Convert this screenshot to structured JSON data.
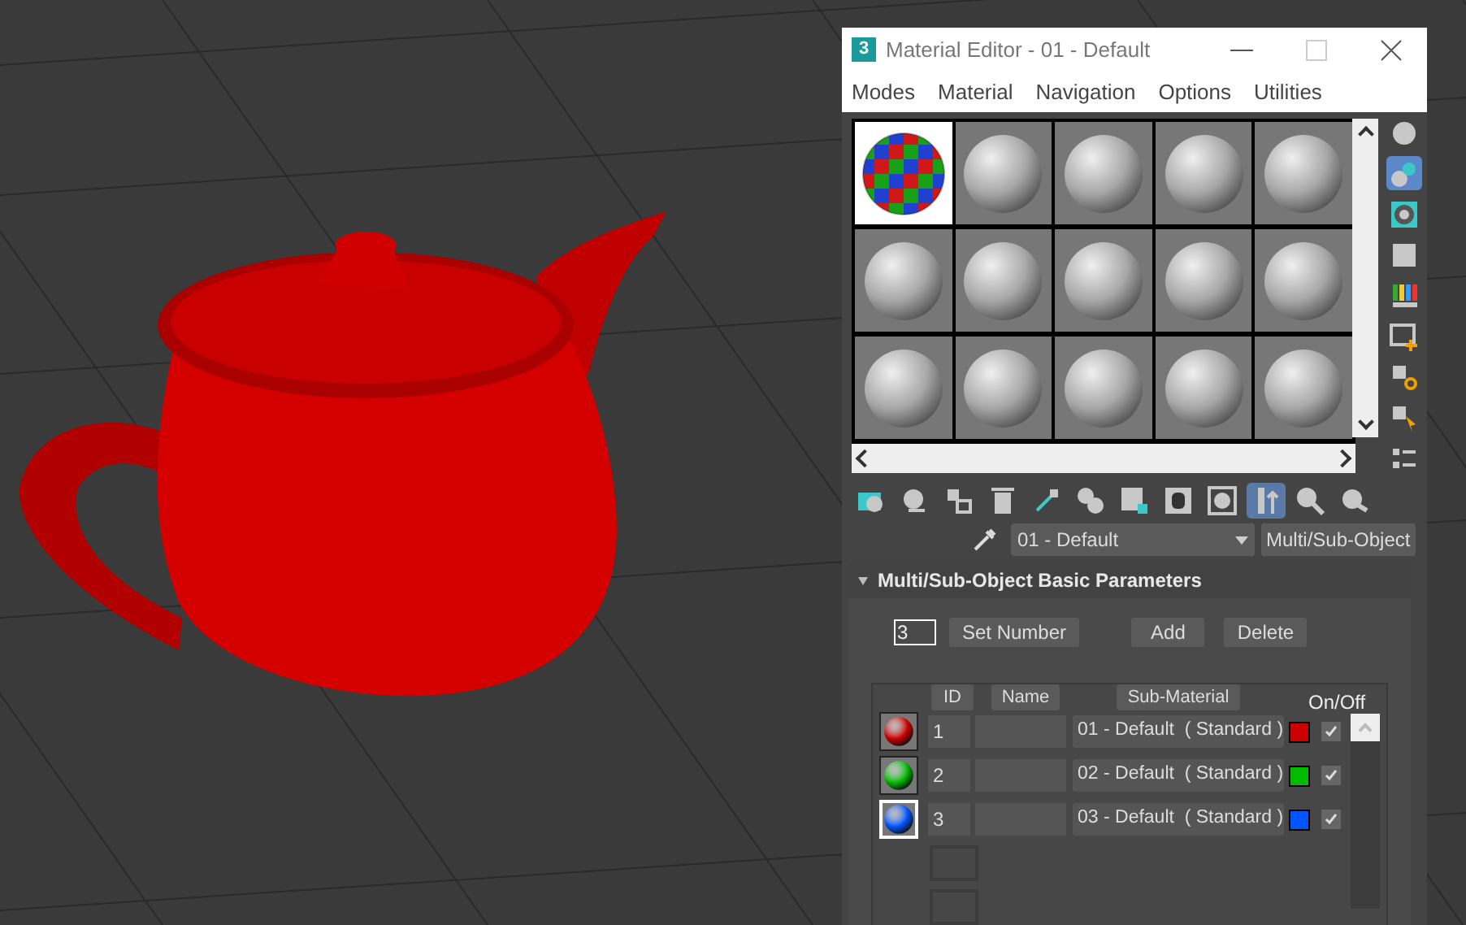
{
  "window": {
    "title": "Material Editor - 01 - Default",
    "app_badge": "3"
  },
  "menu": [
    "Modes",
    "Material",
    "Navigation",
    "Options",
    "Utilities"
  ],
  "slots": [
    {
      "kind": "checker",
      "selected": true
    },
    {
      "kind": "plain",
      "selected": false
    },
    {
      "kind": "plain",
      "selected": false
    },
    {
      "kind": "plain",
      "selected": false
    },
    {
      "kind": "plain",
      "selected": false
    },
    {
      "kind": "plain",
      "selected": false
    },
    {
      "kind": "plain",
      "selected": false
    },
    {
      "kind": "plain",
      "selected": false
    },
    {
      "kind": "plain",
      "selected": false
    },
    {
      "kind": "plain",
      "selected": false
    },
    {
      "kind": "plain",
      "selected": false
    },
    {
      "kind": "plain",
      "selected": false
    },
    {
      "kind": "plain",
      "selected": false
    },
    {
      "kind": "plain",
      "selected": false
    },
    {
      "kind": "plain",
      "selected": false
    }
  ],
  "side_tools": [
    {
      "kind": "sphere",
      "selected": false
    },
    {
      "kind": "light",
      "selected": true
    },
    {
      "kind": "checker",
      "selected": false
    },
    {
      "kind": "square",
      "selected": false
    },
    {
      "kind": "bars",
      "selected": false
    },
    {
      "kind": "film",
      "selected": false
    },
    {
      "kind": "options",
      "selected": false
    },
    {
      "kind": "pick",
      "selected": false
    },
    {
      "kind": "list",
      "selected": false
    }
  ],
  "toolbar": [
    {
      "kind": "get",
      "selected": false
    },
    {
      "kind": "put",
      "selected": false
    },
    {
      "kind": "assign",
      "selected": false
    },
    {
      "kind": "delete",
      "selected": false
    },
    {
      "kind": "copy",
      "selected": false
    },
    {
      "kind": "unique",
      "selected": false
    },
    {
      "kind": "save",
      "selected": false
    },
    {
      "kind": "channel",
      "selected": false
    },
    {
      "kind": "map",
      "selected": false
    },
    {
      "kind": "show",
      "selected": true
    },
    {
      "kind": "parent",
      "selected": false
    },
    {
      "kind": "sibling",
      "selected": false
    }
  ],
  "material": {
    "name": "01 - Default",
    "type": "Multi/Sub-Object"
  },
  "rollout": {
    "title": "Multi/Sub-Object Basic Parameters",
    "expanded": true,
    "count": "3",
    "buttons": [
      "Set Number",
      "Add",
      "Delete"
    ],
    "columns": [
      "ID",
      "Name",
      "Sub-Material",
      "On/Off"
    ],
    "rows": [
      {
        "id": "1",
        "name_value": "",
        "sub_material": "01 - Default  ( Standard )",
        "color": "#cc0000",
        "on": true,
        "selected": false
      },
      {
        "id": "2",
        "name_value": "",
        "sub_material": "02 - Default  ( Standard )",
        "color": "#00bb00",
        "on": true,
        "selected": false
      },
      {
        "id": "3",
        "name_value": "",
        "sub_material": "03 - Default  ( Standard )",
        "color": "#0055ff",
        "on": true,
        "selected": true
      }
    ]
  }
}
